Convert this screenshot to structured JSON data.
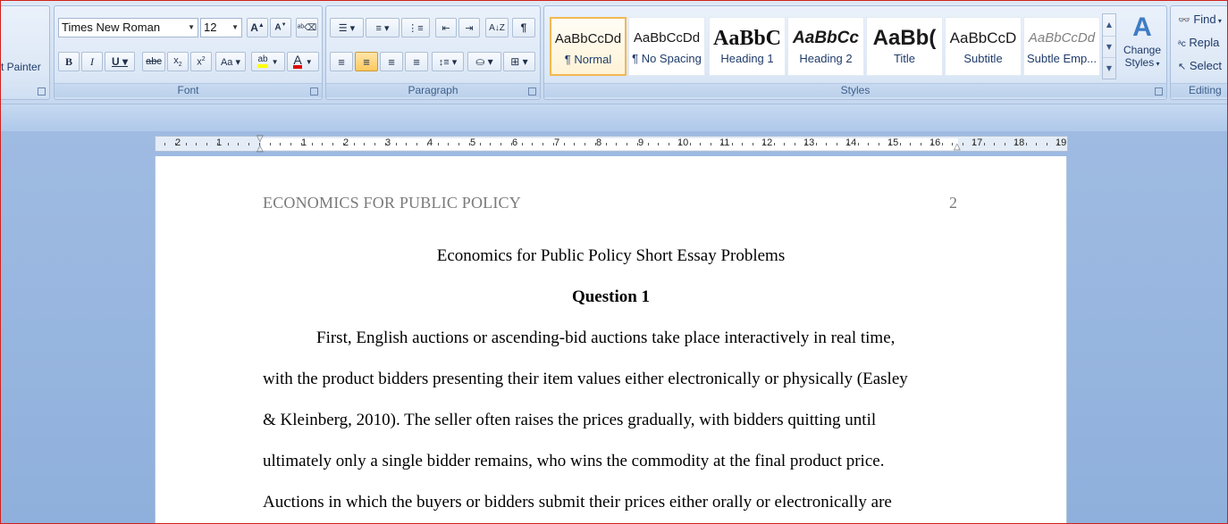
{
  "ribbon": {
    "clipboard": {
      "format_painter_label": "t Painter"
    },
    "font": {
      "group_label": "Font",
      "font_name": "Times New Roman",
      "font_size": "12"
    },
    "paragraph": {
      "group_label": "Paragraph"
    },
    "styles": {
      "group_label": "Styles",
      "tiles": [
        {
          "sample": "AaBbCcDd",
          "name": "¶ Normal"
        },
        {
          "sample": "AaBbCcDd",
          "name": "¶ No Spacing"
        },
        {
          "sample": "AaBbC",
          "name": "Heading 1"
        },
        {
          "sample": "AaBbCc",
          "name": "Heading 2"
        },
        {
          "sample": "AaBb(",
          "name": "Title"
        },
        {
          "sample": "AaBbCcD",
          "name": "Subtitle"
        },
        {
          "sample": "AaBbCcDd",
          "name": "Subtle Emp..."
        }
      ],
      "change_styles_line1": "Change",
      "change_styles_line2": "Styles"
    },
    "editing": {
      "group_label": "Editing",
      "find_label": "Find",
      "replace_label": "Repla",
      "select_label": "Select"
    }
  },
  "ruler": {
    "numbers": [
      "2",
      "1",
      "1",
      "2",
      "3",
      "4",
      "5",
      "6",
      "7",
      "8",
      "9",
      "10",
      "11",
      "12",
      "13",
      "14",
      "15",
      "16",
      "17",
      "18",
      "19"
    ]
  },
  "document": {
    "header_left": "ECONOMICS FOR PUBLIC POLICY",
    "page_number": "2",
    "title": "Economics for Public Policy Short Essay Problems",
    "question_heading": "Question 1",
    "lines": [
      "First, English auctions or ascending-bid auctions take place interactively in real time,",
      "with the product bidders presenting their item values either electronically or physically (Easley",
      "& Kleinberg, 2010). The seller often raises the prices gradually, with bidders quitting until",
      "ultimately only a single bidder remains, who wins the commodity at the final product price.",
      "Auctions in which the buyers or bidders submit their prices either orally or electronically are"
    ]
  },
  "colors": {
    "highlight": "#ffff00",
    "font_color": "#e00000",
    "accent_border": "#d0211d"
  }
}
